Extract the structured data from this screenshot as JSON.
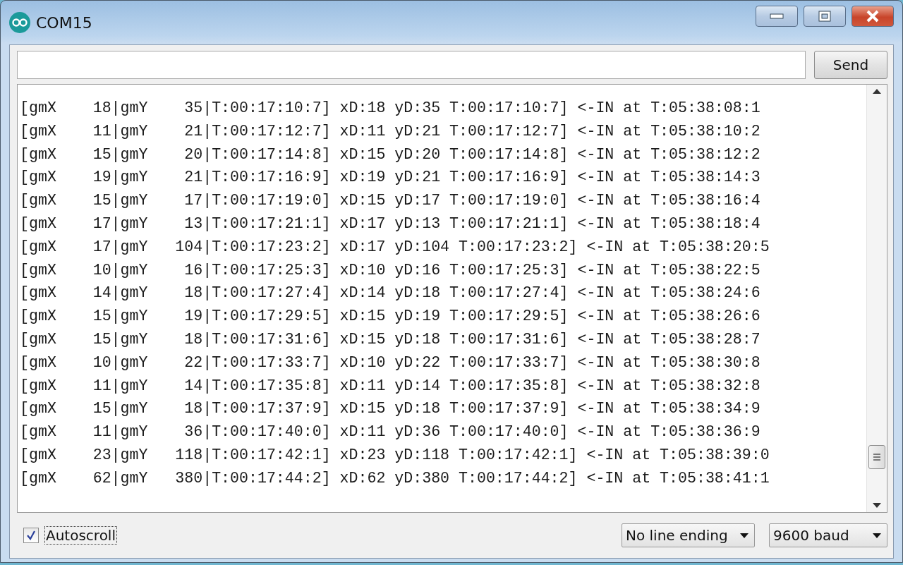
{
  "window": {
    "title": "COM15"
  },
  "send_button": {
    "label": "Send"
  },
  "log_lines": [
    "[gmX    18|gmY    35|T:00:17:10:7] xD:18 yD:35 T:00:17:10:7] <-IN at T:05:38:08:1",
    "[gmX    11|gmY    21|T:00:17:12:7] xD:11 yD:21 T:00:17:12:7] <-IN at T:05:38:10:2",
    "[gmX    15|gmY    20|T:00:17:14:8] xD:15 yD:20 T:00:17:14:8] <-IN at T:05:38:12:2",
    "[gmX    19|gmY    21|T:00:17:16:9] xD:19 yD:21 T:00:17:16:9] <-IN at T:05:38:14:3",
    "[gmX    15|gmY    17|T:00:17:19:0] xD:15 yD:17 T:00:17:19:0] <-IN at T:05:38:16:4",
    "[gmX    17|gmY    13|T:00:17:21:1] xD:17 yD:13 T:00:17:21:1] <-IN at T:05:38:18:4",
    "[gmX    17|gmY   104|T:00:17:23:2] xD:17 yD:104 T:00:17:23:2] <-IN at T:05:38:20:5",
    "[gmX    10|gmY    16|T:00:17:25:3] xD:10 yD:16 T:00:17:25:3] <-IN at T:05:38:22:5",
    "[gmX    14|gmY    18|T:00:17:27:4] xD:14 yD:18 T:00:17:27:4] <-IN at T:05:38:24:6",
    "[gmX    15|gmY    19|T:00:17:29:5] xD:15 yD:19 T:00:17:29:5] <-IN at T:05:38:26:6",
    "[gmX    15|gmY    18|T:00:17:31:6] xD:15 yD:18 T:00:17:31:6] <-IN at T:05:38:28:7",
    "[gmX    10|gmY    22|T:00:17:33:7] xD:10 yD:22 T:00:17:33:7] <-IN at T:05:38:30:8",
    "[gmX    11|gmY    14|T:00:17:35:8] xD:11 yD:14 T:00:17:35:8] <-IN at T:05:38:32:8",
    "[gmX    15|gmY    18|T:00:17:37:9] xD:15 yD:18 T:00:17:37:9] <-IN at T:05:38:34:9",
    "[gmX    11|gmY    36|T:00:17:40:0] xD:11 yD:36 T:00:17:40:0] <-IN at T:05:38:36:9",
    "[gmX    23|gmY   118|T:00:17:42:1] xD:23 yD:118 T:00:17:42:1] <-IN at T:05:38:39:0",
    "[gmX    62|gmY   380|T:00:17:44:2] xD:62 yD:380 T:00:17:44:2] <-IN at T:05:38:41:1"
  ],
  "autoscroll": {
    "label": "Autoscroll",
    "checked": true
  },
  "line_ending": {
    "value": "No line ending"
  },
  "baud_rate": {
    "value": "9600 baud"
  }
}
